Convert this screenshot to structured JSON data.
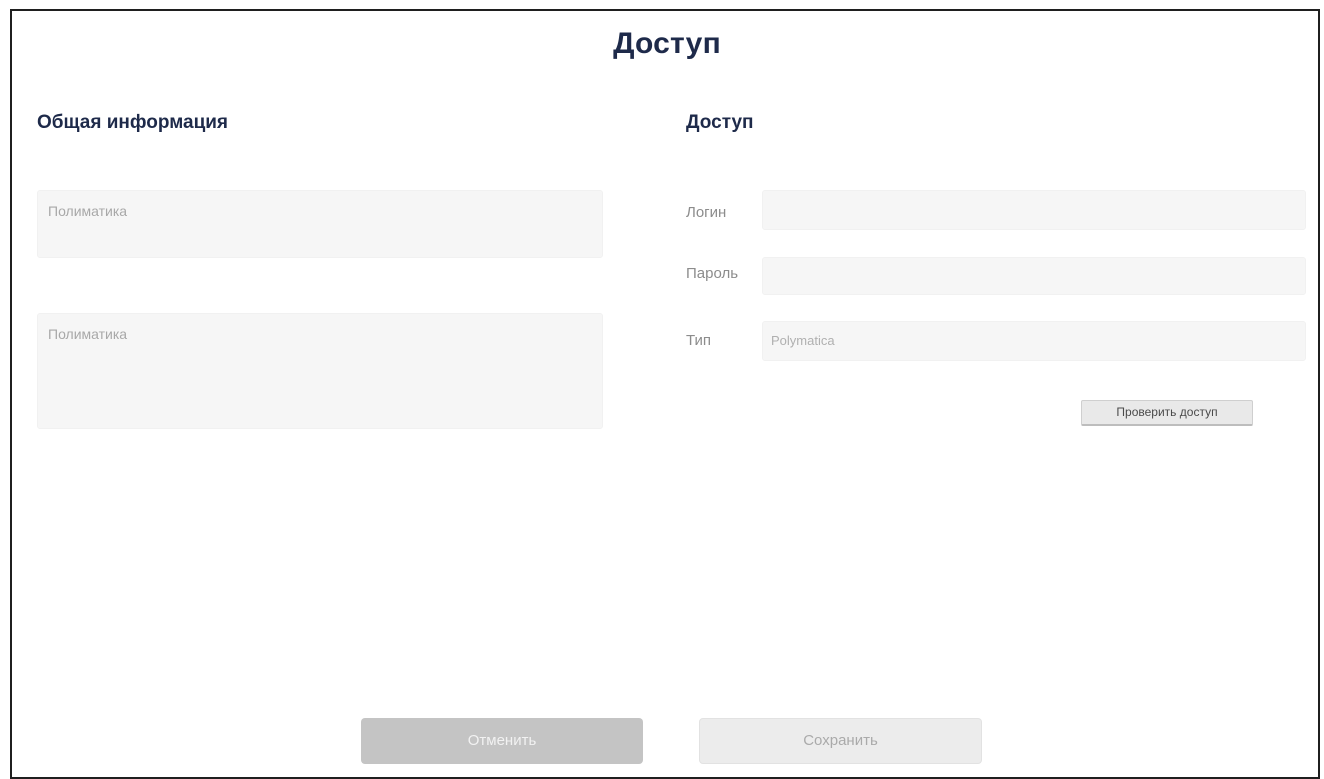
{
  "page": {
    "title": "Доступ"
  },
  "general": {
    "title": "Общая информация",
    "name_placeholder": "Полиматика",
    "description_placeholder": "Полиматика"
  },
  "access": {
    "title": "Доступ",
    "login_label": "Логин",
    "login_value": "",
    "password_label": "Пароль",
    "password_value": "",
    "type_label": "Тип",
    "type_placeholder": "Polymatica",
    "check_button_label": "Проверить доступ"
  },
  "footer": {
    "cancel_label": "Отменить",
    "save_label": "Сохранить"
  }
}
